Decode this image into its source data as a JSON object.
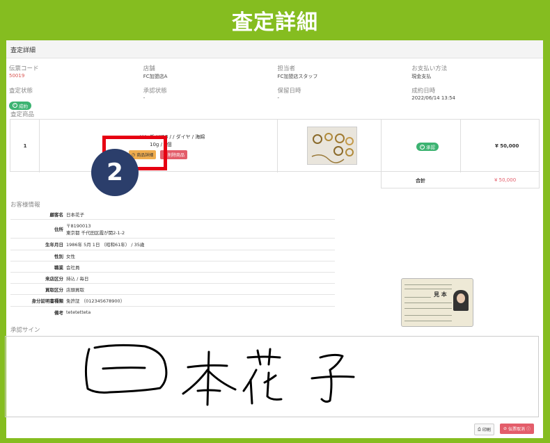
{
  "banner": {
    "title": "査定詳細"
  },
  "panel": {
    "header": "査定詳細"
  },
  "info_row1": [
    {
      "label": "伝票コード",
      "value": "50019"
    },
    {
      "label": "店舗",
      "value": "FC加盟店A"
    },
    {
      "label": "担当者",
      "value": "FC加盟店スタッフ"
    },
    {
      "label": "お支払い方法",
      "value": "現金支払"
    }
  ],
  "info_row2": [
    {
      "label": "査定状態",
      "badge": "成約"
    },
    {
      "label": "承認状態",
      "value": "-"
    },
    {
      "label": "保留日時",
      "value": "-"
    },
    {
      "label": "成約日時",
      "value": "2022/06/14 13:54"
    }
  ],
  "goods": {
    "section_label": "査定商品",
    "index": "1",
    "desc_line1": "リング / K18 / / ダイヤ / 海綿",
    "desc_line2": "10g / 1個",
    "btn_detail": "商品詳細",
    "btn_delete": "削除商品",
    "approve_badge": "承認",
    "price": "¥ 50,000",
    "total_label": "合計",
    "total_value": "¥ 50,000"
  },
  "callout": {
    "number": "2"
  },
  "customer": {
    "section_label": "お客様情報",
    "rows": [
      {
        "key": "顧客名",
        "value": "日本花子"
      },
      {
        "key": "住所",
        "value": "〒8190013",
        "value2": "東京都 千代田区霞が関2-1-2"
      },
      {
        "key": "生年月日",
        "value": "1986年 5月 1日 （昭和61年） / 35歳"
      },
      {
        "key": "性別",
        "value": "女性"
      },
      {
        "key": "職業",
        "value": "会社員"
      },
      {
        "key": "来店区分",
        "value": "持込 / 毎日"
      },
      {
        "key": "買取区分",
        "value": "店頭買取"
      },
      {
        "key": "身分証明書種類",
        "value": "免許証 （012345678900）"
      },
      {
        "key": "備考",
        "value": "tetetetteta"
      }
    ]
  },
  "idcard": {
    "name": "見 本"
  },
  "sign": {
    "section_label": "承認サイン"
  },
  "footer": {
    "print": "印刷",
    "cancel": "伝票取消"
  },
  "colors": {
    "accent_green": "#85bd20",
    "callout_red": "#e60012",
    "callout_navy": "#2b3e6b",
    "danger": "#e35d6a"
  }
}
